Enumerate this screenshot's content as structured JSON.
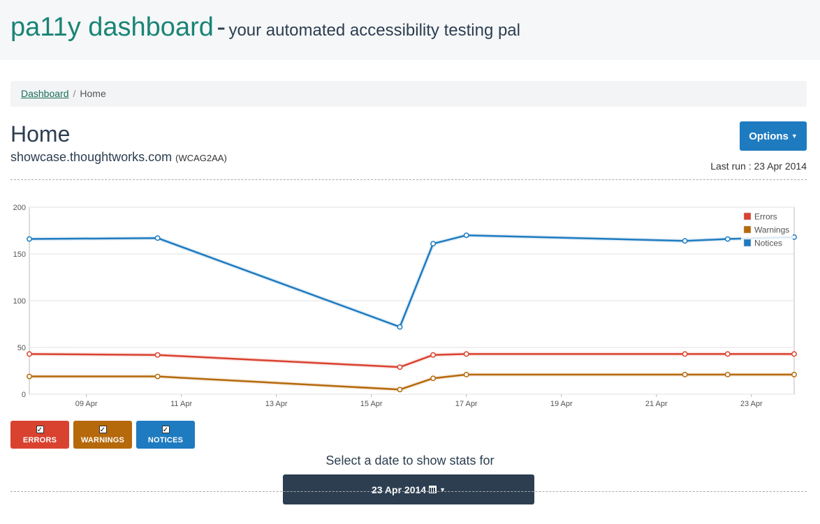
{
  "header": {
    "brand": "pa11y dashboard",
    "dash": "-",
    "tagline": "your automated accessibility testing pal"
  },
  "breadcrumb": {
    "link": "Dashboard",
    "separator": "/",
    "current": "Home"
  },
  "task": {
    "title": "Home",
    "url": "showcase.thoughtworks.com",
    "standard": "(WCAG2AA)",
    "last_run": "Last run : 23 Apr 2014"
  },
  "options_label": "Options",
  "toggles": [
    {
      "label": "ERRORS",
      "checked": true,
      "color": "#d9422f"
    },
    {
      "label": "WARNINGS",
      "checked": true,
      "color": "#b5690b"
    },
    {
      "label": "NOTICES",
      "checked": true,
      "color": "#1e7bc0"
    }
  ],
  "select_label": "Select a date to show stats for",
  "date_button": "23 Apr 2014",
  "chart_data": {
    "type": "line",
    "ylim": [
      0,
      200
    ],
    "yticks": [
      0,
      50,
      100,
      150,
      200
    ],
    "xlim": [
      7.8,
      23.9
    ],
    "xticks": [
      9,
      11,
      13,
      15,
      17,
      19,
      21,
      23
    ],
    "xtick_labels": [
      "09 Apr",
      "11 Apr",
      "13 Apr",
      "15 Apr",
      "17 Apr",
      "19 Apr",
      "21 Apr",
      "23 Apr"
    ],
    "x": [
      7.8,
      10.5,
      15.6,
      16.3,
      17.0,
      21.6,
      22.5,
      23.9
    ],
    "grid": true,
    "legend_position": "top-right",
    "series": [
      {
        "name": "Errors",
        "color": "#d9422f",
        "values": [
          43,
          42,
          29,
          42,
          43,
          43,
          43,
          43
        ]
      },
      {
        "name": "Warnings",
        "color": "#b5690b",
        "values": [
          19,
          19,
          5,
          17,
          21,
          21,
          21,
          21
        ]
      },
      {
        "name": "Notices",
        "color": "#1e7bc0",
        "values": [
          166,
          167,
          72,
          161,
          170,
          164,
          166,
          168
        ]
      }
    ]
  }
}
